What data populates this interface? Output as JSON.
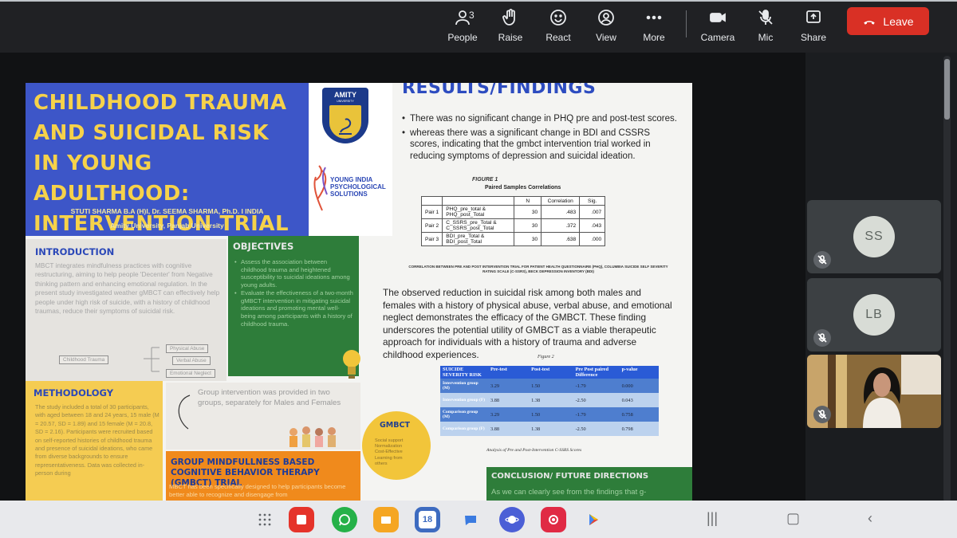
{
  "toolbar": {
    "people": {
      "label": "People",
      "count": "3"
    },
    "raise": {
      "label": "Raise"
    },
    "react": {
      "label": "React"
    },
    "view": {
      "label": "View"
    },
    "more": {
      "label": "More"
    },
    "camera": {
      "label": "Camera"
    },
    "mic": {
      "label": "Mic"
    },
    "share": {
      "label": "Share"
    },
    "leave": {
      "label": "Leave"
    }
  },
  "slide": {
    "title": "CHILDHOOD TRAUMA AND SUICIDAL RISK IN YOUNG ADULTHOOD: INTERVENTION TRIAL",
    "authors": "STUTI SHARMA B.A (H)I, Dr. SEEMA SHARMA, Ph.D. I INDIA",
    "affiliation": "Amity University, Panjab University",
    "logo_name": "AMITY",
    "logo_sub": "UNIVERSITY",
    "yips": [
      "YOUNG INDIA",
      "PSYCHOLOGICAL",
      "SOLUTIONS"
    ],
    "results_title": "RESULTS/FINDINGS",
    "results_bullets": [
      "There was no significant change in PHQ pre and post-test scores.",
      "whereas there was a significant change in BDI and CSSRS scores, indicating that the gmbct intervention trial worked in reducing symptoms of depression and suicidal ideation."
    ],
    "figure1": {
      "caption": "FIGURE 1",
      "title": "Paired Samples Correlations",
      "headers": [
        "",
        "",
        "N",
        "Correlation",
        "Sig."
      ],
      "rows": [
        [
          "Pair 1",
          "PHQ_pre_total & PHQ_post_Total",
          "30",
          ".483",
          ".007"
        ],
        [
          "Pair 2",
          "C_SSRS_pre_Total & C_SSRS_post_Total",
          "30",
          ".372",
          ".043"
        ],
        [
          "Pair 3",
          "BDI_pre_Total & BDI_post_Total",
          "30",
          ".638",
          ".000"
        ]
      ],
      "note": "CORRELATION BETWEEN PRE AND POST INTERVENTION TRIAL FOR PATIENT HEALTH QUESTIONNAIRE (PHQ), COLUMBIA SUICIDE SELF SEVERITY RATING SCALE (C-SSRS), BECK DEPRESSION INVENTORY (BDI)"
    },
    "paragraph": "The observed reduction in suicidal risk among both males and females with a history of physical abuse, verbal abuse, and emotional neglect demonstrates the efficacy of the GMBCT. These finding underscores the potential utility of GMBCT as a viable therapeutic approach for individuals with a history of trauma and adverse childhood experiences.",
    "figure2": {
      "caption": "Figure 2",
      "headers": [
        "SUICIDE SEVERITY RISK",
        "Pre-test",
        "Post-test",
        "Pre Post paired Difference",
        "p-value"
      ],
      "rows": [
        [
          "Intervention group (M)",
          "3.29",
          "1.50",
          "-1.79",
          "0.000"
        ],
        [
          "Intervention group (F)",
          "3.88",
          "1.38",
          "-2.50",
          "0.043"
        ],
        [
          "Comparison group (M)",
          "3.29",
          "1.50",
          "-1.79",
          "0.758"
        ],
        [
          "Comparison group (F)",
          "3.88",
          "1.38",
          "-2.50",
          "0.798"
        ]
      ],
      "note": "Analysis of Pre and Post-Intervention C-SSRS Scores"
    },
    "introduction": {
      "heading": "INTRODUCTION",
      "body": "MBCT integrates mindfulness practices with cognitive restructuring, aiming to help people 'Decenter' from Negative thinking pattern and enhancing emotional regulation. In the present study investigated weather gMBCT can effectively help people under high risk of suicide, with a history of childhood traumas, reduce their symptoms of suicidal risk.",
      "tree_root": "Childhood Trauma",
      "tree_leaves": [
        "Physical Abuse",
        "Verbal Abuse",
        "Emotional Neglect"
      ]
    },
    "objectives": {
      "heading": "OBJECTIVES",
      "items": [
        "Assess the association between childhood trauma and heightened susceptibility to suicidal ideations among young adults.",
        "Evaluate the effectiveness of a two-month gMBCT intervention in mitigating suicidal ideations and promoting mental well-being among participants with a history of childhood trauma."
      ]
    },
    "methodology": {
      "heading": "METHODOLOGY",
      "body": "The study included a total of 30 participants, with aged between 18 and 24 years, 15 male (M = 20.57, SD = 1.89) and 15 female (M = 20.8, SD = 2.16). Participants were recruited based on self-reported histories of childhood trauma and presence of suicidal ideations, who came from diverse backgrounds to ensure representativeness. Data was collected in-person during"
    },
    "group_text": "Group intervention was provided in two groups, separately for Males and Females",
    "gmbct_head": {
      "title": "GROUP MINDFULLNESS BASED COGNITIVE BEHAVIOR THERAPY (GMBCT) TRIAL",
      "body": "MBCT has been specifically designed to help participants become better able to recognize and disengage from"
    },
    "gmbct_circle": {
      "heading": "GMBCT",
      "items": [
        "Social support",
        "Normalization",
        "Cost-Effective",
        "Learning from",
        "others"
      ]
    },
    "conclusion": {
      "heading": "CONCLUSION/ FUTURE DIRECTIONS",
      "body": "As we can clearly see from the findings that g-"
    }
  },
  "participants": [
    {
      "initials": "SS",
      "muted": true
    },
    {
      "initials": "LB",
      "muted": true
    },
    {
      "initials": "",
      "muted": true,
      "video": true
    }
  ],
  "dock": {
    "calendar_day": "18"
  }
}
